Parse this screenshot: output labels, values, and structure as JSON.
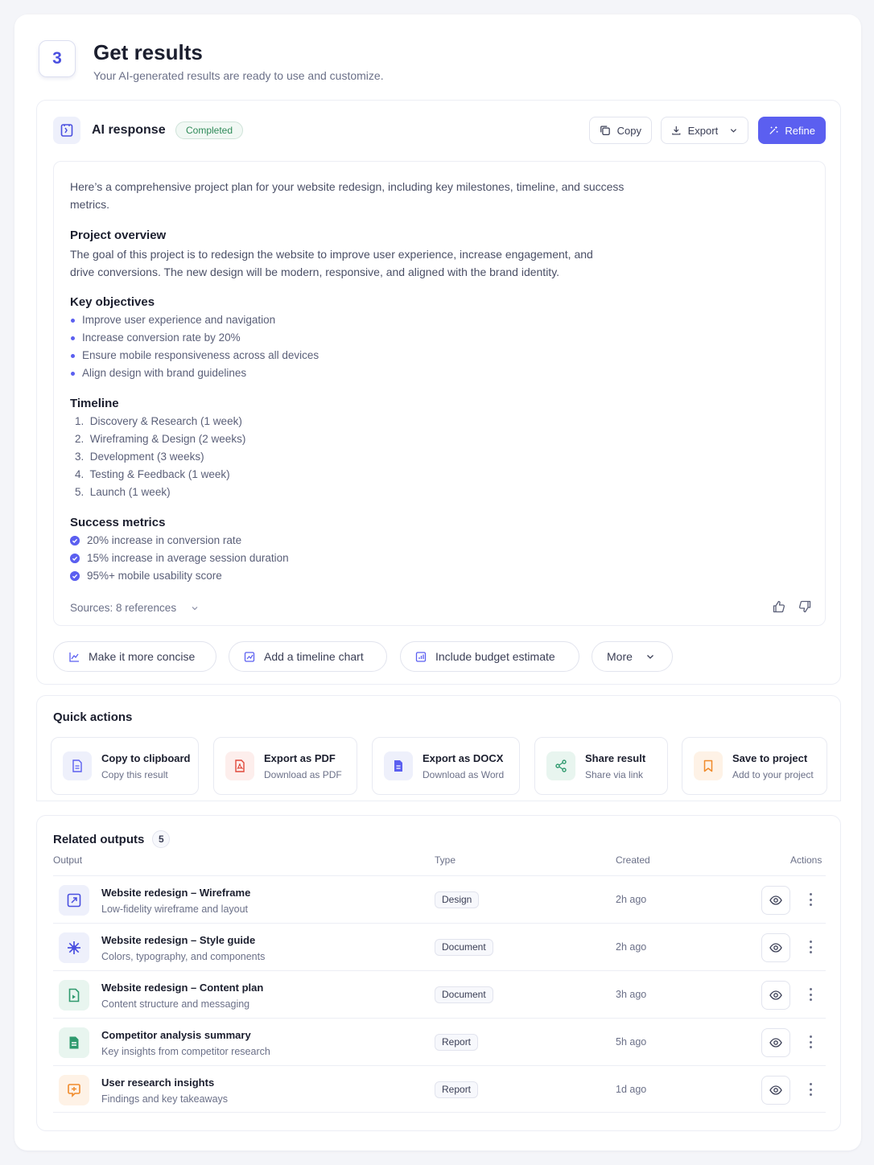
{
  "header": {
    "step_number": "3",
    "title": "Get results",
    "subtitle": "Your AI-generated results are ready to use and customize."
  },
  "ai_response": {
    "title": "AI response",
    "status": "Completed",
    "copy_label": "Copy",
    "export_label": "Export",
    "refine_label": "Refine",
    "intro": "Here’s a comprehensive project plan for your website redesign, including key milestones, timeline, and success metrics.",
    "overview": {
      "heading": "Project overview",
      "body": "The goal of this project is to redesign the website to improve user experience, increase engagement, and drive conversions. The new design will be modern, responsive, and aligned with the brand identity."
    },
    "objectives": {
      "heading": "Key objectives",
      "items": [
        "Improve user experience and navigation",
        "Increase conversion rate by 20%",
        "Ensure mobile responsiveness across all devices",
        "Align design with brand guidelines"
      ]
    },
    "timeline": {
      "heading": "Timeline",
      "items": [
        "1.  Discovery & Research (1 week)",
        "2.  Wireframing & Design (2 weeks)",
        "3.  Development (3 weeks)",
        "4.  Testing & Feedback (1 week)",
        "5.  Launch (1 week)"
      ]
    },
    "metrics": {
      "heading": "Success metrics",
      "items": [
        "20% increase in conversion rate",
        "15% increase in average session duration",
        "95%+ mobile usability score"
      ]
    },
    "sources": "Sources: 8 references",
    "suggestions": [
      "Make it more concise",
      "Add a timeline chart",
      "Include budget estimate",
      "More"
    ]
  },
  "quick_actions": {
    "title": "Quick actions",
    "items": [
      {
        "title": "Copy to clipboard",
        "subtitle": "Copy this result",
        "icon": "document-icon"
      },
      {
        "title": "Export as PDF",
        "subtitle": "Download as PDF",
        "icon": "pdf-icon"
      },
      {
        "title": "Export as DOCX",
        "subtitle": "Download as Word",
        "icon": "word-doc-icon"
      },
      {
        "title": "Share result",
        "subtitle": "Share via link",
        "icon": "share-icon"
      },
      {
        "title": "Save to project",
        "subtitle": "Add to your project",
        "icon": "bookmark-icon"
      }
    ]
  },
  "related": {
    "title": "Related outputs",
    "count": "5",
    "columns": [
      "Output",
      "Type",
      "Created",
      "Actions"
    ],
    "rows": [
      {
        "title": "Website redesign – Wireframe",
        "subtitle": "Low-fidelity wireframe and layout",
        "type": "Design",
        "created": "2h ago",
        "icon": "wireframe-icon"
      },
      {
        "title": "Website redesign – Style guide",
        "subtitle": "Colors, typography, and components",
        "type": "Document",
        "created": "2h ago",
        "icon": "sparkle-icon"
      },
      {
        "title": "Website redesign – Content plan",
        "subtitle": "Content structure and messaging",
        "type": "Document",
        "created": "3h ago",
        "icon": "content-doc-icon"
      },
      {
        "title": "Competitor analysis summary",
        "subtitle": "Key insights from competitor research",
        "type": "Report",
        "created": "5h ago",
        "icon": "report-icon"
      },
      {
        "title": "User research insights",
        "subtitle": "Findings and key takeaways",
        "type": "Report",
        "created": "1d ago",
        "icon": "insight-icon"
      }
    ]
  },
  "colors": {
    "accent": "#5b5ff0",
    "success": "#2e8a58",
    "pdf_red": "#e0483b",
    "share_green": "#2f9a6e",
    "bookmark_orange": "#f08a2a"
  }
}
